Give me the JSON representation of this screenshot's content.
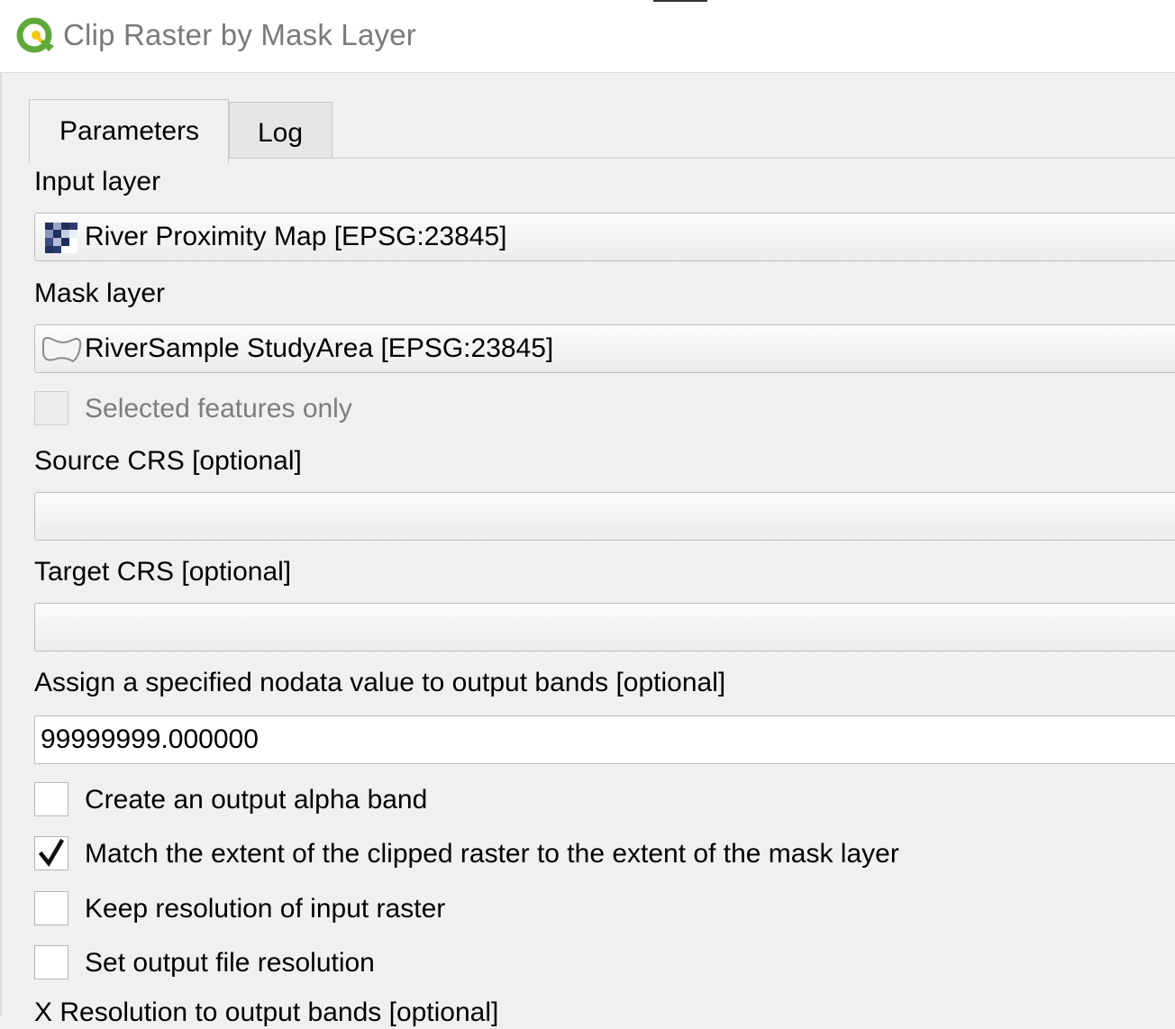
{
  "window": {
    "title": "Clip Raster by Mask Layer",
    "logo_icon": "qgis-logo-icon"
  },
  "tabs": [
    {
      "label": "Parameters",
      "active": true
    },
    {
      "label": "Log",
      "active": false
    }
  ],
  "form": {
    "input_layer": {
      "label": "Input layer",
      "value": "River Proximity Map [EPSG:23845]",
      "icon": "raster-layer-icon"
    },
    "mask_layer": {
      "label": "Mask layer",
      "value": "RiverSample StudyArea [EPSG:23845]",
      "icon": "polygon-layer-icon"
    },
    "selected_features_only": {
      "label": "Selected features only",
      "checked": false,
      "enabled": false
    },
    "source_crs": {
      "label": "Source CRS [optional]",
      "value": ""
    },
    "target_crs": {
      "label": "Target CRS [optional]",
      "value": ""
    },
    "nodata": {
      "label": "Assign a specified nodata value to output bands [optional]",
      "value": "99999999.000000"
    },
    "alpha_band": {
      "label": "Create an output alpha band",
      "checked": false
    },
    "match_extent": {
      "label": "Match the extent of the clipped raster to the extent of the mask layer",
      "checked": true
    },
    "keep_resolution": {
      "label": "Keep resolution of input raster",
      "checked": false
    },
    "set_resolution": {
      "label": "Set output file resolution",
      "checked": false
    },
    "x_resolution": {
      "label": "X Resolution to output bands [optional]"
    }
  },
  "colors": {
    "window_bg": "#f0f0f0",
    "titlebar_bg": "#ffffff",
    "title_text": "#7a7a7a",
    "logo_green": "#5fa83a",
    "logo_yellow": "#f2c811"
  }
}
